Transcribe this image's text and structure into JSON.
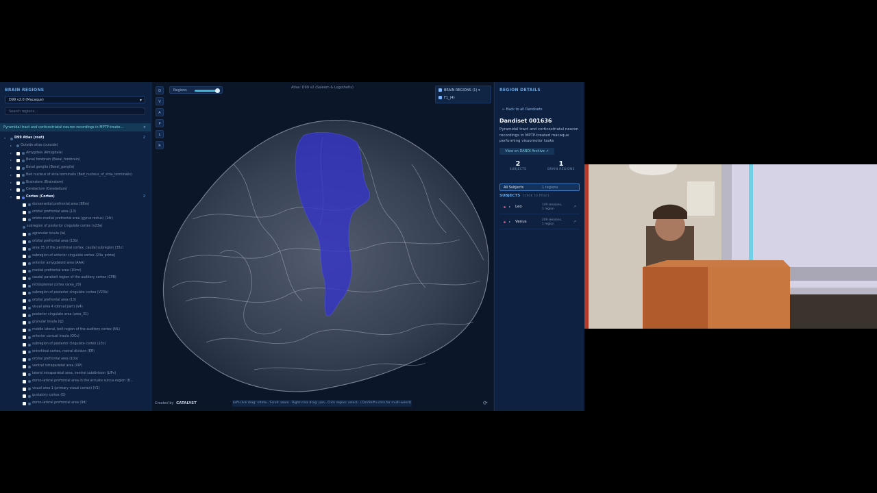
{
  "left_panel": {
    "title": "BRAIN REGIONS",
    "atlas_selected": "D99 v2.0 (Macaque)",
    "search_placeholder": "Search regions...",
    "dandiset_filter": "Pyramidal tract and corticostriatal neuron recordings in MPTP-treate...",
    "close_icon": "×",
    "tree": [
      {
        "label": "D99 Atlas (root)",
        "indent": 0,
        "checkbox": false,
        "bold": true,
        "count": "2"
      },
      {
        "label": "Outside atlas (outside)",
        "indent": 1,
        "checkbox": false
      },
      {
        "label": "Amygdala (Amygdala)",
        "indent": 1,
        "checkbox": true
      },
      {
        "label": "Basal forebrain (Basal_forebrain)",
        "indent": 1,
        "checkbox": true
      },
      {
        "label": "Basal ganglia (Basal_ganglia)",
        "indent": 1,
        "checkbox": true
      },
      {
        "label": "Bed nucleus of stria terminalis (Bed_nucleus_of_stria_terminalis)",
        "indent": 1,
        "checkbox": true
      },
      {
        "label": "Brainstem (Brainstem)",
        "indent": 1,
        "checkbox": true
      },
      {
        "label": "Cerebellum (Cerebellum)",
        "indent": 1,
        "checkbox": true
      },
      {
        "label": "Cortex (Cortex)",
        "indent": 1,
        "checkbox": true,
        "bold": true,
        "cortex": true,
        "count": "2"
      },
      {
        "label": "dorsomedial prefrontal area (8Bm)",
        "indent": 2,
        "checkbox": true
      },
      {
        "label": "orbital prefrontal area (13)",
        "indent": 2,
        "checkbox": true
      },
      {
        "label": "orbito-medial prefrontal area (gyrus rectus) (14r)",
        "indent": 2,
        "checkbox": true
      },
      {
        "label": "subregion of posterior cingulate cortex (v23a)",
        "indent": 2,
        "checkbox": false
      },
      {
        "label": "agranular insula (Ia)",
        "indent": 2,
        "checkbox": true
      },
      {
        "label": "orbital prefrontal area (13b)",
        "indent": 2,
        "checkbox": true
      },
      {
        "label": "area 35 of the perirhinal cortex, caudal subregion (35c)",
        "indent": 2,
        "checkbox": true
      },
      {
        "label": "subregion of anterior cingulate cortex (24a_prime)",
        "indent": 2,
        "checkbox": true
      },
      {
        "label": "anterior amygdaloid area (AAA)",
        "indent": 2,
        "checkbox": true
      },
      {
        "label": "medial prefrontal area (10mr)",
        "indent": 2,
        "checkbox": true
      },
      {
        "label": "caudal parabelt region of the auditory cortex (CPB)",
        "indent": 2,
        "checkbox": true
      },
      {
        "label": "retrosplenial cortex (area_29)",
        "indent": 2,
        "checkbox": true
      },
      {
        "label": "subregion of posterior cingulate cortex (V23b)",
        "indent": 2,
        "checkbox": true
      },
      {
        "label": "orbital prefrontal area (13)",
        "indent": 2,
        "checkbox": true
      },
      {
        "label": "visual area 4 (dorsal part) (V4)",
        "indent": 2,
        "checkbox": true
      },
      {
        "label": "posterior cingulate area (area_31)",
        "indent": 2,
        "checkbox": true
      },
      {
        "label": "granular insula (Ig)",
        "indent": 2,
        "checkbox": true
      },
      {
        "label": "middle lateral, belt region of the auditory cortex (ML)",
        "indent": 2,
        "checkbox": true
      },
      {
        "label": "anterior cursual insula (OCc)",
        "indent": 2,
        "checkbox": true
      },
      {
        "label": "subregion of posterior cingulate cortex (23c)",
        "indent": 2,
        "checkbox": true
      },
      {
        "label": "entorhinal cortex, rostral division (ER)",
        "indent": 2,
        "checkbox": true
      },
      {
        "label": "orbital prefrontal area (10o)",
        "indent": 2,
        "checkbox": true
      },
      {
        "label": "ventral intraparietal area (VIP)",
        "indent": 2,
        "checkbox": true
      },
      {
        "label": "lateral intraparietal area, ventral subdivision (LIPv)",
        "indent": 2,
        "checkbox": true
      },
      {
        "label": "dorso-lateral prefrontal area in the arcuate sulcus region (8...",
        "indent": 2,
        "checkbox": true
      },
      {
        "label": "visual area 1 (primary visual cortex) (V1)",
        "indent": 2,
        "checkbox": true
      },
      {
        "label": "gustatory cortex (G)",
        "indent": 2,
        "checkbox": true
      },
      {
        "label": "dorso-lateral prefrontal area (9d)",
        "indent": 2,
        "checkbox": true
      }
    ]
  },
  "viewer": {
    "view_buttons": [
      "D",
      "V",
      "A",
      "P",
      "L",
      "R"
    ],
    "regions_control_label": "Regions",
    "regions_opacity": 0.85,
    "atlas_label": "Atlas: D99 v2 (Saleem & Logothetis)",
    "brain_regions_header": "BRAIN REGIONS (1)",
    "brain_regions_items": [
      "F1_(4)"
    ],
    "created_by": "Created by",
    "brand": "CATALYST",
    "hint": "Left-click drag: rotate · Scroll: zoom · Right-click drag: pan · Click region: select · (Ctrl/Shift+click for multi-select)",
    "region_color": "#3535c8"
  },
  "right_panel": {
    "title": "REGION DETAILS",
    "back_link": "← Back to all Dandisets",
    "dandiset_id": "Dandiset 001636",
    "description": "Pyramidal tract and corticostriatal neuron recordings in MPTP-treated macaque performing visuomotor tasks",
    "view_link": "View on DANDI Archive ↗",
    "stats": [
      {
        "value": "2",
        "label": "SUBJECTS"
      },
      {
        "value": "1",
        "label": "BRAIN REGIONS"
      }
    ],
    "all_subjects": {
      "label": "All Subjects",
      "meta": "1 regions"
    },
    "subjects_label": "SUBJECTS",
    "subjects_hint": "(click to filter)",
    "subjects": [
      {
        "name": "Leo",
        "sessions": "149 sessions,",
        "regions": "1 region"
      },
      {
        "name": "Venus",
        "sessions": "209 sessions,",
        "regions": "1 region"
      }
    ]
  }
}
